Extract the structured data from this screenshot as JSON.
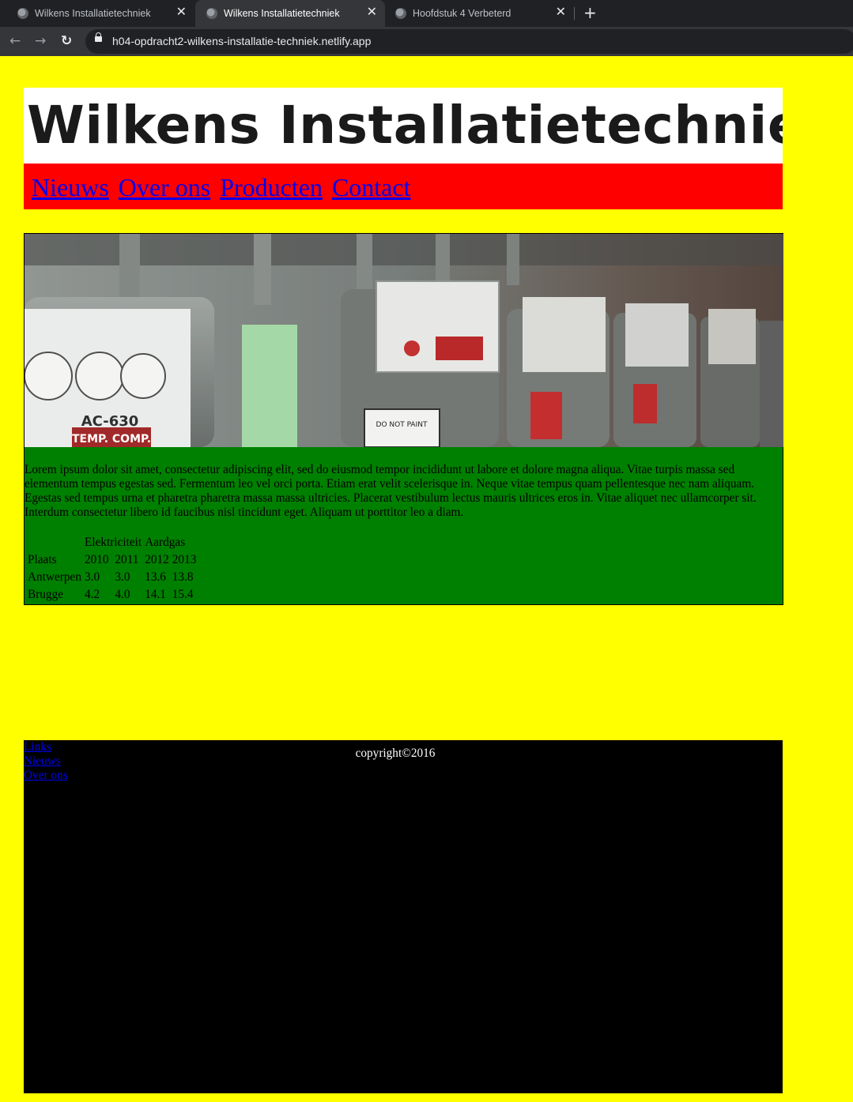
{
  "browser": {
    "tabs": [
      {
        "title": "Wilkens Installatietechniek",
        "close": "✕"
      },
      {
        "title": "Wilkens Installatietechniek",
        "close": "✕"
      },
      {
        "title": "Hoofdstuk 4 Verbeterd",
        "close": "✕"
      }
    ],
    "new_tab": "+",
    "icons": {
      "back": "←",
      "forward": "→",
      "reload": "↻"
    },
    "url": "h04-opdracht2-wilkens-installatie-techniek.netlify.app"
  },
  "header": {
    "logo_text": "Wilkens Installatietechniek",
    "nav": [
      "Nieuws",
      "Over ons",
      "Producten",
      "Contact"
    ]
  },
  "main": {
    "hero_image": "gas-meters-photo",
    "meter_labels": {
      "model": "AC-630",
      "badge": "TEMP. COMP.",
      "warning": "DO NOT PAINT"
    },
    "paragraph": "Lorem ipsum dolor sit amet, consectetur adipiscing elit, sed do eiusmod tempor incididunt ut labore et dolore magna aliqua. Vitae turpis massa sed elementum tempus egestas sed. Fermentum leo vel orci porta. Etiam erat velit scelerisque in. Neque vitae tempus quam pellentesque nec nam aliquam. Egestas sed tempus urna et pharetra pharetra massa massa ultricies. Placerat vestibulum lectus mauris ultrices eros in. Vitae aliquet nec ullamcorper sit. Interdum consectetur libero id faucibus nisl tincidunt eget. Aliquam ut porttitor leo a diam.",
    "table": {
      "group_headers": [
        "Elektriciteit",
        "Aardgas"
      ],
      "year_label": "Plaats",
      "years": [
        "2010",
        "2011",
        "2012",
        "2013"
      ],
      "rows": [
        {
          "place": "Antwerpen",
          "values": [
            "3.0",
            "3.0",
            "13.6",
            "13.8"
          ]
        },
        {
          "place": "Brugge",
          "values": [
            "4.2",
            "4.0",
            "14.1",
            "15.4"
          ]
        }
      ]
    }
  },
  "footer": {
    "links": [
      "Links",
      "Nieuws",
      "Over ons"
    ],
    "copyright": "copyright©2016"
  },
  "colors": {
    "page": "#ffff00",
    "nav": "#ff0000",
    "content": "#008000",
    "footer": "#000000",
    "link": "#0000ee"
  }
}
